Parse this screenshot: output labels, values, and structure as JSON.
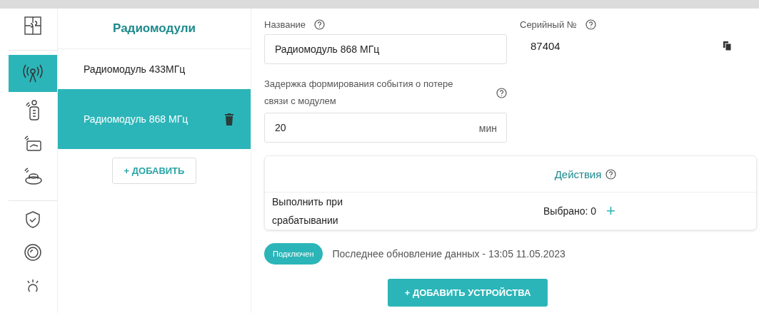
{
  "rail": [
    {
      "kind": "puzzle",
      "selected": false
    },
    {
      "kind": "antenna",
      "selected": true
    },
    {
      "kind": "keyfob",
      "selected": false
    },
    {
      "kind": "switch",
      "selected": false
    },
    {
      "kind": "button",
      "selected": false
    },
    {
      "kind": "shield",
      "selected": false
    },
    {
      "kind": "disk",
      "selected": false
    },
    {
      "kind": "lamp",
      "selected": false
    }
  ],
  "list": {
    "title": "Радиомодули",
    "items": [
      {
        "label": "Радиомодуль 433МГц",
        "selected": false
      },
      {
        "label": "Радиомодуль 868 МГц",
        "selected": true
      }
    ],
    "add_button": "+ ДОБАВИТЬ"
  },
  "form": {
    "name_label": "Название",
    "name_value": "Радиомодуль 868 МГц",
    "serial_label": "Серийный №",
    "serial_value": "87404",
    "delay_label": "Задержка формирования события о потере связи с модулем",
    "delay_value": "20",
    "delay_unit": "мин"
  },
  "actions": {
    "title": "Действия",
    "row_label": "Выполнить при срабатывании",
    "row_value": "Выбрано: 0",
    "add": "+"
  },
  "status": {
    "badge": "Подключен",
    "text": "Последнее обновление данных - 13:05 11.05.2023"
  },
  "add_devices_button": "+ ДОБАВИТЬ УСТРОЙСТВА"
}
